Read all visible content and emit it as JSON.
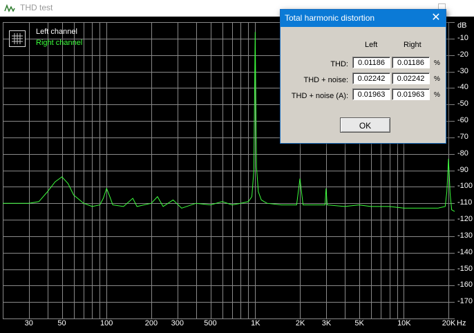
{
  "window": {
    "title": "THD test"
  },
  "legend": {
    "left_label": "Left channel",
    "right_label": "Right channel"
  },
  "axis": {
    "y_unit": "dB",
    "y_ticks": [
      "-10",
      "-20",
      "-30",
      "-40",
      "-50",
      "-60",
      "-70",
      "-80",
      "-90",
      "-100",
      "-110",
      "-120",
      "-130",
      "-140",
      "-150",
      "-160",
      "-170"
    ],
    "x_unit": "Hz",
    "x_ticks": [
      "30",
      "50",
      "100",
      "200",
      "300",
      "500",
      "1K",
      "2K",
      "3K",
      "5K",
      "10K",
      "20K"
    ]
  },
  "dialog": {
    "title": "Total harmonic distortion",
    "col_left": "Left",
    "col_right": "Right",
    "rows": [
      {
        "label": "THD:",
        "left": "0.01186",
        "right": "0.01186",
        "unit": "%"
      },
      {
        "label": "THD + noise:",
        "left": "0.02242",
        "right": "0.02242",
        "unit": "%"
      },
      {
        "label": "THD + noise (A):",
        "left": "0.01963",
        "right": "0.01963",
        "unit": "%"
      }
    ],
    "ok_label": "OK"
  },
  "colors": {
    "trace": "#3cff3c",
    "grid": "#8a8a8a",
    "background": "#000000",
    "dialog_title": "#0b7ad6"
  },
  "chart_data": {
    "type": "line",
    "xscale": "log",
    "xlim": [
      20,
      22000
    ],
    "ylim": [
      -180,
      0
    ],
    "xlabel": "Hz",
    "ylabel": "dB",
    "grid": true,
    "series": [
      {
        "name": "Right channel",
        "points": [
          [
            20,
            -110
          ],
          [
            25,
            -110
          ],
          [
            30,
            -110
          ],
          [
            35,
            -109
          ],
          [
            40,
            -103
          ],
          [
            45,
            -97
          ],
          [
            50,
            -94
          ],
          [
            55,
            -98
          ],
          [
            60,
            -105
          ],
          [
            70,
            -110
          ],
          [
            80,
            -112
          ],
          [
            90,
            -111
          ],
          [
            95,
            -107
          ],
          [
            100,
            -101
          ],
          [
            105,
            -106
          ],
          [
            110,
            -111
          ],
          [
            130,
            -112
          ],
          [
            150,
            -107
          ],
          [
            160,
            -112
          ],
          [
            200,
            -110
          ],
          [
            220,
            -106
          ],
          [
            240,
            -112
          ],
          [
            280,
            -108
          ],
          [
            320,
            -113
          ],
          [
            400,
            -110
          ],
          [
            500,
            -111
          ],
          [
            600,
            -109
          ],
          [
            700,
            -111
          ],
          [
            800,
            -110
          ],
          [
            900,
            -109
          ],
          [
            950,
            -106
          ],
          [
            980,
            -90
          ],
          [
            1000,
            -6
          ],
          [
            1020,
            -88
          ],
          [
            1050,
            -103
          ],
          [
            1100,
            -108
          ],
          [
            1200,
            -110
          ],
          [
            1500,
            -111
          ],
          [
            1900,
            -111
          ],
          [
            2000,
            -95
          ],
          [
            2100,
            -111
          ],
          [
            2500,
            -111
          ],
          [
            2950,
            -111
          ],
          [
            3000,
            -101
          ],
          [
            3050,
            -111
          ],
          [
            4000,
            -112
          ],
          [
            5000,
            -111
          ],
          [
            6000,
            -112
          ],
          [
            8000,
            -112
          ],
          [
            10000,
            -113
          ],
          [
            12000,
            -113
          ],
          [
            15000,
            -113
          ],
          [
            17000,
            -113
          ],
          [
            19000,
            -112
          ],
          [
            19500,
            -103
          ],
          [
            20000,
            -83
          ],
          [
            20500,
            -104
          ],
          [
            21000,
            -114
          ],
          [
            22000,
            -115
          ]
        ]
      }
    ]
  }
}
